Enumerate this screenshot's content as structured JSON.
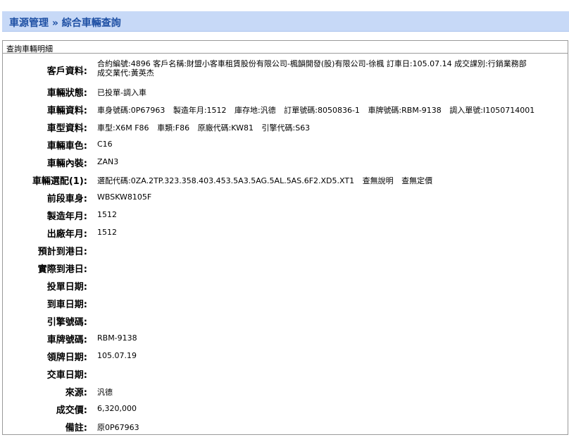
{
  "header": {
    "title": "車源管理 » 綜合車輛查詢"
  },
  "panel": {
    "title": "查詢車輛明細"
  },
  "fields": {
    "customer": {
      "label": "客戶資料:",
      "line1": "合約編號:4896 客戶名稱:財盟小客車租賃股份有限公司-楓韻開發(股)有限公司-徐楓 訂車日:105.07.14 成交課別:行銷業務部",
      "line2": "成交業代:黃英杰"
    },
    "status": {
      "label": "車輛狀態:",
      "value": "已投單-調入車"
    },
    "vehicle": {
      "label": "車輛資料:",
      "body_no": "車身號碼:0P67963",
      "build_ym": "製造年月:1512",
      "location": "庫存地:汎德",
      "order_no": "訂單號碼:8050836-1",
      "plate": "車牌號碼:RBM-9138",
      "transfer_no": "調入單號:I1050714001"
    },
    "model": {
      "label": "車型資料:",
      "model": "車型:X6M F86",
      "type": "車類:F86",
      "factory_code": "原廠代碼:KW81",
      "engine_code": "引擎代碼:S63"
    },
    "color": {
      "label": "車輛車色:",
      "value": "C16"
    },
    "interior": {
      "label": "車輛內裝:",
      "value": "ZAN3"
    },
    "options": {
      "label": "車輛選配(1):",
      "value": "選配代碼:0ZA.2TP.323.358.403.453.5A3.5AG.5AL.5AS.6F2.XD5.XT1",
      "link_desc": "查無說明",
      "link_price": "查無定價"
    },
    "prev_body": {
      "label": "前段車身:",
      "value": "WBSKW8105F"
    },
    "build_date": {
      "label": "製造年月:",
      "value": "1512"
    },
    "factory_date": {
      "label": "出廠年月:",
      "value": "1512"
    },
    "eta_port": {
      "label": "預計到港日:",
      "value": ""
    },
    "ata_port": {
      "label": "實際到港日:",
      "value": ""
    },
    "order_date": {
      "label": "投單日期:",
      "value": ""
    },
    "arrival_date": {
      "label": "到車日期:",
      "value": ""
    },
    "engine_no": {
      "label": "引擎號碼:",
      "value": ""
    },
    "plate_no": {
      "label": "車牌號碼:",
      "value": "RBM-9138"
    },
    "plate_date": {
      "label": "領牌日期:",
      "value": "105.07.19"
    },
    "delivery_date": {
      "label": "交車日期:",
      "value": ""
    },
    "source": {
      "label": "來源:",
      "value": "汎德"
    },
    "price": {
      "label": "成交價:",
      "value": "6,320,000"
    },
    "remark": {
      "label": "備註:",
      "value": "原0P67963"
    }
  }
}
